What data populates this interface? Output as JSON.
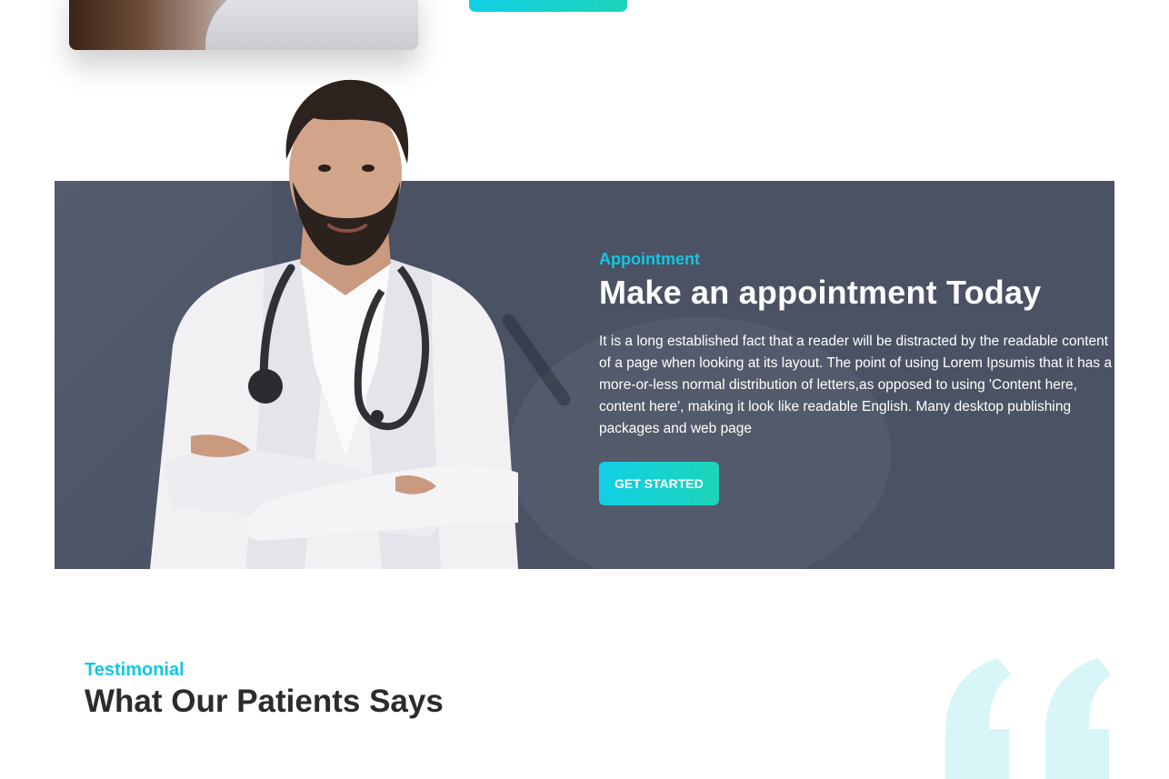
{
  "appointment": {
    "eyebrow": "Appointment",
    "heading": "Make an appointment Today",
    "paragraph": "It is a long established fact that a reader will be distracted by the readable content of a page when looking at its layout. The point of using Lorem Ipsumis that it has a more-or-less normal distribution of letters,as opposed to using 'Content here, content here', making it look like readable English. Many desktop publishing packages and web page",
    "cta_label": "GET STARTED"
  },
  "testimonial": {
    "eyebrow": "Testimonial",
    "heading": "What Our Patients Says"
  },
  "colors": {
    "accent": "#14c6e3",
    "accent_gradient_end": "#1dd5b8",
    "banner_bg": "#4a5264",
    "quote_mark": "#d8f6f7"
  },
  "icons": {
    "quote": "quote-icon"
  }
}
